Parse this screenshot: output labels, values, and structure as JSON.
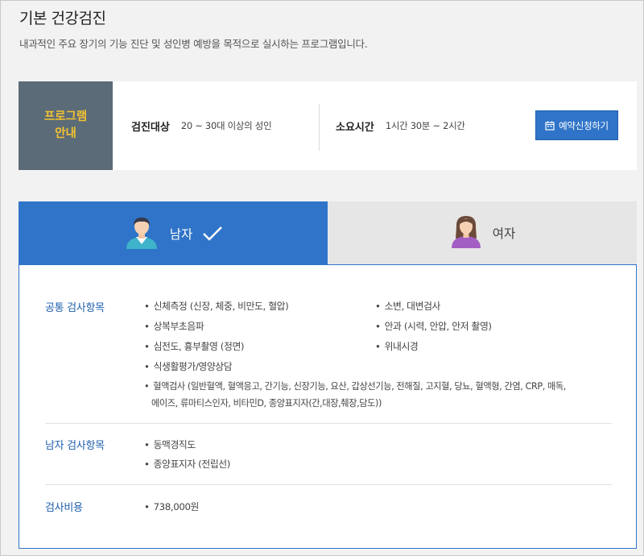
{
  "page": {
    "title": "기본 건강검진",
    "description": "내과적인 주요 장기의 기능 진단 및 성인병 예방을 목적으로 실시하는 프로그램입니다."
  },
  "info": {
    "program_line1": "프로그램",
    "program_line2": "안내",
    "target_label": "검진대상",
    "target_value": "20 ~ 30대 이상의 성인",
    "time_label": "소요시간",
    "time_value": "1시간 30분 ~ 2시간",
    "reserve_label": "예약신청하기"
  },
  "tabs": {
    "male": "남자",
    "female": "여자",
    "active": "male"
  },
  "sections": {
    "common_label": "공통 검사항목",
    "common_left": [
      "신체측정 (신장, 체중, 비만도, 혈압)",
      "상복부초음파",
      "심전도, 흉부촬영 (정면)",
      "식생활평가/영양상담"
    ],
    "common_right": [
      "소변, 대변검사",
      "안과 (시력, 안압, 안저 촬영)",
      "위내시경"
    ],
    "blood_line1": "혈액검사 (일반혈액, 혈액응고, 간기능, 신장기능, 요산, 갑상선기능, 전해질, 고지혈, 당뇨, 혈액형, 간염, CRP, 매독,",
    "blood_line2": "에이즈, 류마티스인자, 비타민D, 종양표지자(간,대장,췌장,담도))",
    "male_label": "남자 검사항목",
    "male_items": [
      "동맥경직도",
      "종양표지자 (전립선)"
    ],
    "cost_label": "검사비용",
    "cost_value": "738,000원"
  },
  "colors": {
    "accent": "#2f74c8",
    "program_bg": "#5c6b78",
    "program_text": "#f2c230",
    "section_label": "#1f5fae"
  }
}
